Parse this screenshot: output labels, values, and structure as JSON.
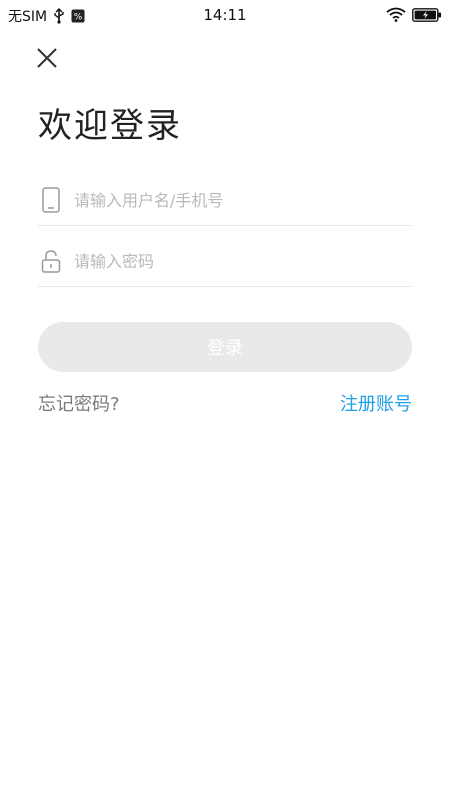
{
  "status_bar": {
    "carrier": "无SIM",
    "time": "14:11"
  },
  "page": {
    "title": "欢迎登录"
  },
  "form": {
    "username_placeholder": "请输入用户名/手机号",
    "password_placeholder": "请输入密码",
    "login_label": "登录",
    "forgot_label": "忘记密码?",
    "register_label": "注册账号"
  },
  "colors": {
    "accent": "#1ea0e6",
    "button_disabled_bg": "#e9e9e9",
    "placeholder": "#b9b9b9"
  },
  "icons": {
    "usb": "usb-icon",
    "notification": "notification-icon",
    "wifi": "wifi-icon",
    "battery": "battery-charging-icon",
    "close": "close-icon",
    "phone": "phone-icon",
    "lock": "lock-icon"
  }
}
